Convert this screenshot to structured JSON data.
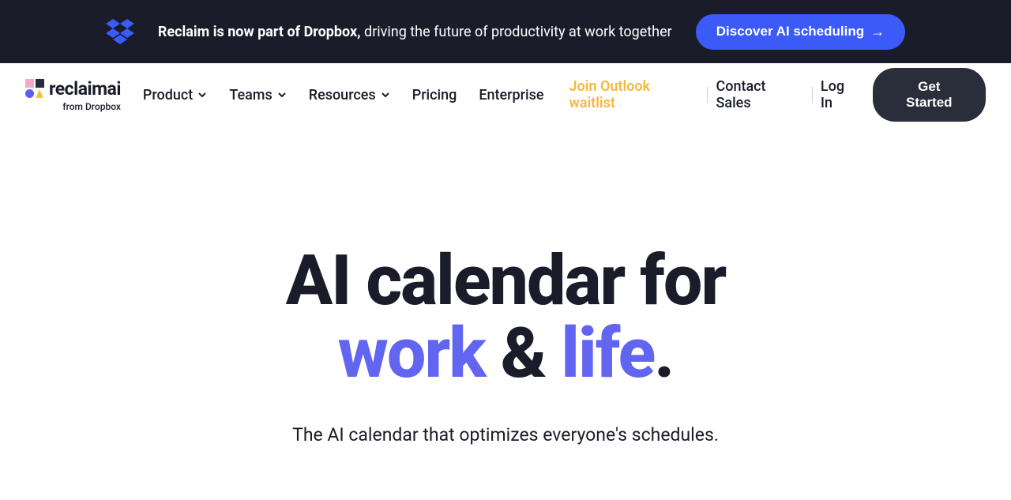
{
  "banner": {
    "text_bold": "Reclaim is now part of Dropbox,",
    "text_rest": " driving the future of productivity at work together",
    "button_label": "Discover AI scheduling"
  },
  "logo": {
    "brand": "reclaimai",
    "subtitle": "from Dropbox"
  },
  "nav": {
    "product": "Product",
    "teams": "Teams",
    "resources": "Resources",
    "pricing": "Pricing",
    "enterprise": "Enterprise",
    "outlook": "Join Outlook waitlist",
    "contact": "Contact Sales",
    "login": "Log In",
    "cta": "Get Started"
  },
  "hero": {
    "line1": "AI calendar for",
    "word1": "work",
    "amp": " & ",
    "word2": "life",
    "period": ".",
    "sub": "The AI calendar that optimizes everyone's schedules."
  }
}
